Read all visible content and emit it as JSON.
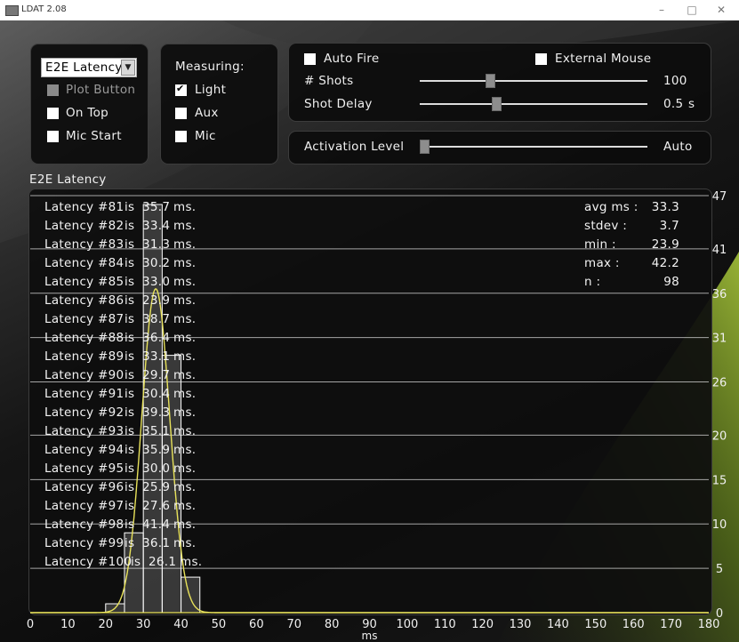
{
  "window": {
    "title": "LDAT 2.08",
    "min": "–",
    "max": "□",
    "close": "✕"
  },
  "left_panel": {
    "mode_select": "E2E Latency",
    "plot_button": "Plot Button",
    "on_top": "On Top",
    "mic_start": "Mic Start"
  },
  "measuring": {
    "title": "Measuring:",
    "light": "Light",
    "aux": "Aux",
    "mic": "Mic"
  },
  "controls": {
    "auto_fire": "Auto Fire",
    "external_mouse": "External Mouse",
    "shots_label": "# Shots",
    "shots_value": "100",
    "shots_level": 0.3,
    "shot_delay_label": "Shot Delay",
    "shot_delay_value": "0.5",
    "shot_delay_unit": "s",
    "shot_delay_level": 0.33,
    "activation_label": "Activation Level",
    "activation_value": "Auto",
    "activation_level": 0.0
  },
  "chart_title": "E2E Latency",
  "latency_lines": [
    {
      "label": "Latency #81",
      "is": "is",
      "value": "35.7",
      "unit": "ms."
    },
    {
      "label": "Latency #82",
      "is": "is",
      "value": "33.4",
      "unit": "ms."
    },
    {
      "label": "Latency #83",
      "is": "is",
      "value": "31.3",
      "unit": "ms."
    },
    {
      "label": "Latency #84",
      "is": "is",
      "value": "30.2",
      "unit": "ms."
    },
    {
      "label": "Latency #85",
      "is": "is",
      "value": "33.0",
      "unit": "ms."
    },
    {
      "label": "Latency #86",
      "is": "is",
      "value": "23.9",
      "unit": "ms."
    },
    {
      "label": "Latency #87",
      "is": "is",
      "value": "38.7",
      "unit": "ms."
    },
    {
      "label": "Latency #88",
      "is": "is",
      "value": "36.4",
      "unit": "ms."
    },
    {
      "label": "Latency #89",
      "is": "is",
      "value": "33.1",
      "unit": "ms."
    },
    {
      "label": "Latency #90",
      "is": "is",
      "value": "29.7",
      "unit": "ms."
    },
    {
      "label": "Latency #91",
      "is": "is",
      "value": "30.4",
      "unit": "ms."
    },
    {
      "label": "Latency #92",
      "is": "is",
      "value": "39.3",
      "unit": "ms."
    },
    {
      "label": "Latency #93",
      "is": "is",
      "value": "35.1",
      "unit": "ms."
    },
    {
      "label": "Latency #94",
      "is": "is",
      "value": "35.9",
      "unit": "ms."
    },
    {
      "label": "Latency #95",
      "is": "is",
      "value": "30.0",
      "unit": "ms."
    },
    {
      "label": "Latency #96",
      "is": "is",
      "value": "25.9",
      "unit": "ms."
    },
    {
      "label": "Latency #97",
      "is": "is",
      "value": "27.6",
      "unit": "ms."
    },
    {
      "label": "Latency #98",
      "is": "is",
      "value": "41.4",
      "unit": "ms."
    },
    {
      "label": "Latency #99",
      "is": "is",
      "value": "36.1",
      "unit": "ms."
    },
    {
      "label": "Latency #100",
      "is": "is",
      "value": "26.1",
      "unit": "ms."
    }
  ],
  "stats": [
    {
      "label": "avg ms :",
      "value": "33.3"
    },
    {
      "label": "stdev :",
      "value": "3.7"
    },
    {
      "label": "min :",
      "value": "23.9"
    },
    {
      "label": "max :",
      "value": "42.2"
    },
    {
      "label": "n :",
      "value": "98"
    }
  ],
  "colors": {
    "curve": "#e8e25a",
    "bars": "#ffffff",
    "grid": "#d8d8d8"
  },
  "chart_data": {
    "type": "bar",
    "title": "E2E Latency",
    "xlabel": "ms",
    "ylabel": "",
    "xlim": [
      0,
      180
    ],
    "ylim": [
      0,
      47
    ],
    "x_ticks": [
      0,
      10,
      20,
      30,
      40,
      50,
      60,
      70,
      80,
      90,
      100,
      110,
      120,
      130,
      140,
      150,
      160,
      170,
      180
    ],
    "y_ticks": [
      0,
      5,
      10,
      15,
      20,
      26,
      31,
      36,
      41,
      47
    ],
    "bins": [
      {
        "x0": 20,
        "x1": 25,
        "count": 1
      },
      {
        "x0": 25,
        "x1": 30,
        "count": 9
      },
      {
        "x0": 30,
        "x1": 35,
        "count": 46
      },
      {
        "x0": 35,
        "x1": 40,
        "count": 29
      },
      {
        "x0": 40,
        "x1": 45,
        "count": 4
      }
    ],
    "fit_curve": {
      "type": "normal",
      "mean": 33.3,
      "stdev": 3.7
    }
  }
}
